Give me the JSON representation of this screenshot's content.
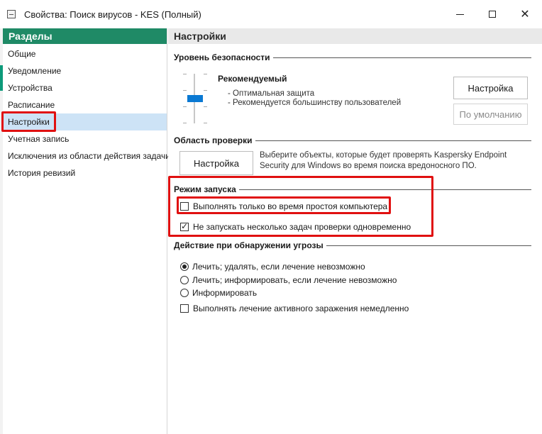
{
  "window": {
    "title": "Свойства: Поиск вирусов - KES (Полный)",
    "icon": "window-app-icon",
    "controls": [
      "minimize-icon",
      "maximize-icon",
      "close-icon"
    ]
  },
  "sidebar": {
    "header": "Разделы",
    "items": [
      {
        "label": "Общие"
      },
      {
        "label": "Уведомление"
      },
      {
        "label": "Устройства"
      },
      {
        "label": "Расписание"
      },
      {
        "label": "Настройки"
      },
      {
        "label": "Учетная запись"
      },
      {
        "label": "Исключения из области действия задачи"
      },
      {
        "label": "История ревизий"
      }
    ],
    "active_index": 4
  },
  "main": {
    "header": "Настройки",
    "security": {
      "heading": "Уровень безопасности",
      "level_title": "Рекомендуемый",
      "desc_line1": "- Оптимальная защита",
      "desc_line2": "- Рекомендуется большинству пользователей",
      "settings_button": "Настройка",
      "default_button": "По умолчанию",
      "level": "Рекомендуемый"
    },
    "scope": {
      "heading": "Область проверки",
      "settings_button": "Настройка",
      "description": "Выберите объекты, которые будет проверять Kaspersky Endpoint Security для Windows во время поиска вредоносного ПО."
    },
    "launch_mode": {
      "heading": "Режим запуска",
      "option1": {
        "label": "Выполнять только во время простоя компьютера",
        "checked": false
      },
      "option2": {
        "label": "Не запускать несколько задач проверки одновременно",
        "checked": true
      }
    },
    "threat_action": {
      "heading": "Действие при обнаружении угрозы",
      "radio1": "Лечить; удалять, если лечение невозможно",
      "radio2": "Лечить; информировать, если лечение невозможно",
      "radio3": "Информировать",
      "selected_radio": 1,
      "checkbox": {
        "label": "Выполнять лечение активного заражения немедленно",
        "checked": false
      }
    }
  },
  "colors": {
    "sidebar_header": "#1f8a66",
    "active_item": "#cde3f6",
    "slider_thumb": "#0a79d3",
    "highlight": "#e01010"
  }
}
